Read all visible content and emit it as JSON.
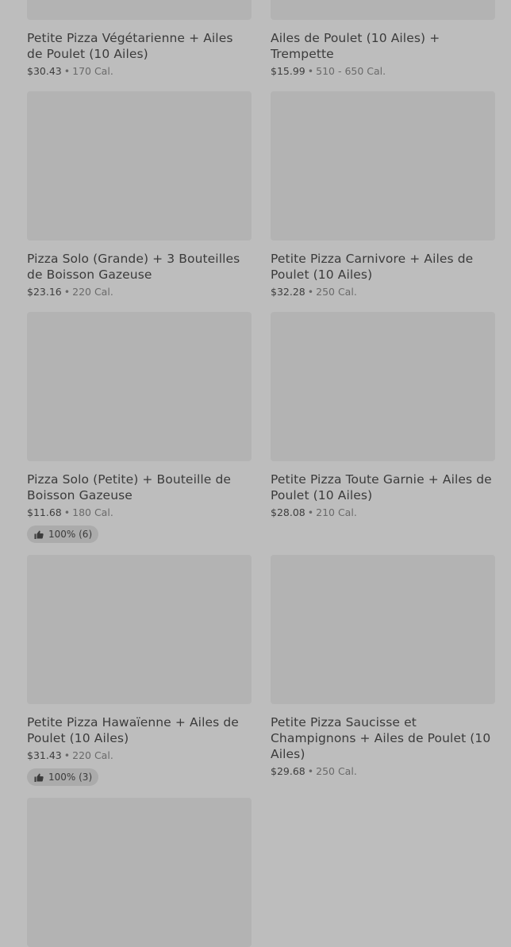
{
  "items": [
    {
      "name": "Petite Pizza Végétarienne + Ailes de Poulet (10 Ailes)",
      "price": "$30.43",
      "sep": "•",
      "cal": "170 Cal."
    },
    {
      "name": "Ailes de Poulet (10 Ailes) + Trempette",
      "price": "$15.99",
      "sep": "•",
      "cal": "510 - 650 Cal."
    },
    {
      "name": "Pizza Solo (Grande) + 3 Bouteilles de Boisson Gazeuse",
      "price": "$23.16",
      "sep": "•",
      "cal": "220 Cal."
    },
    {
      "name": "Petite Pizza Carnivore + Ailes de Poulet (10 Ailes)",
      "price": "$32.28",
      "sep": "•",
      "cal": "250 Cal."
    },
    {
      "name": "Pizza Solo (Petite) + Bouteille de Boisson Gazeuse",
      "price": "$11.68",
      "sep": "•",
      "cal": "180 Cal.",
      "rating": "100% (6)"
    },
    {
      "name": "Petite Pizza Toute Garnie + Ailes de Poulet (10 Ailes)",
      "price": "$28.08",
      "sep": "•",
      "cal": "210 Cal."
    },
    {
      "name": "Petite Pizza Hawaïenne + Ailes de Poulet (10 Ailes)",
      "price": "$31.43",
      "sep": "•",
      "cal": "220 Cal.",
      "rating": "100% (3)"
    },
    {
      "name": "Petite Pizza Saucisse et Champignons + Ailes de Poulet (10 Ailes)",
      "price": "$29.68",
      "sep": "•",
      "cal": "250 Cal."
    }
  ],
  "icons": {
    "rating": "thumbs-up-icon"
  },
  "colors": {
    "background": "#bdbdbd",
    "placeholder": "#b3b3b3",
    "badge": "#ababab"
  }
}
